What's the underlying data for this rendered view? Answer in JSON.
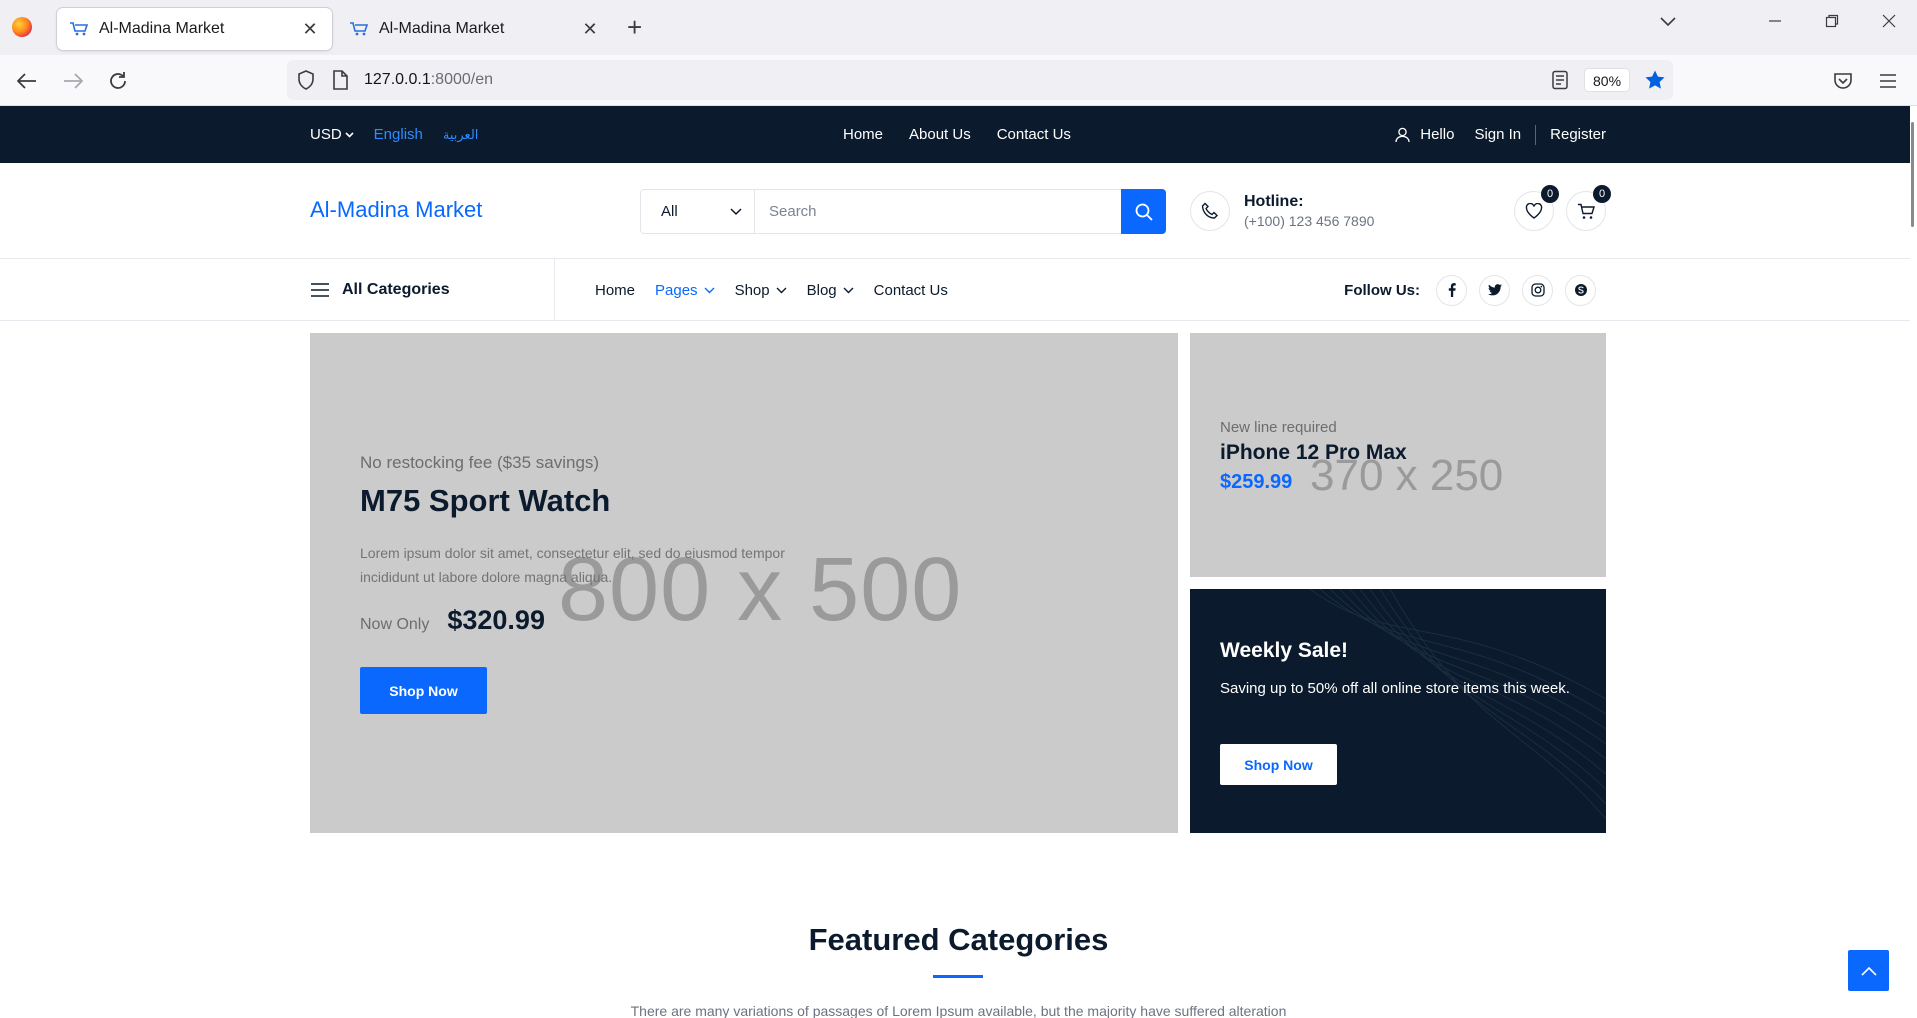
{
  "browser": {
    "tabs": [
      {
        "title": "Al-Madina Market",
        "active": true
      },
      {
        "title": "Al-Madina Market",
        "active": false
      }
    ],
    "url": {
      "host": "127.0.0.1",
      "path": ":8000/en"
    },
    "zoom": "80%"
  },
  "topbar": {
    "currency": "USD",
    "lang_en": "English",
    "lang_ar": "العربية",
    "links": [
      "Home",
      "About Us",
      "Contact Us"
    ],
    "hello": "Hello",
    "sign_in": "Sign In",
    "register": "Register"
  },
  "header": {
    "logo": "Al-Madina Market",
    "search_category": "All",
    "search_placeholder": "Search",
    "hotline_label": "Hotline:",
    "hotline_number": "(+100) 123 456 7890",
    "wishlist_count": "0",
    "cart_count": "0"
  },
  "nav": {
    "all_categories": "All Categories",
    "menu": [
      "Home",
      "Pages",
      "Shop",
      "Blog",
      "Contact Us"
    ],
    "follow_us": "Follow Us:"
  },
  "hero": {
    "placeholder": "800 x 500",
    "subtitle": "No restocking fee ($35 savings)",
    "title": "M75 Sport Watch",
    "description": "Lorem ipsum dolor sit amet, consectetur elit, sed do eiusmod tempor incididunt ut labore dolore magna aliqua.",
    "now_only": "Now Only",
    "price": "$320.99",
    "button": "Shop Now"
  },
  "side_banner_1": {
    "placeholder": "370 x 250",
    "subtitle": "New line required",
    "title": "iPhone 12 Pro Max",
    "price": "$259.99"
  },
  "side_banner_2": {
    "title": "Weekly Sale!",
    "description": "Saving up to 50% off all online store items this week.",
    "button": "Shop Now"
  },
  "featured": {
    "title": "Featured Categories",
    "description": "There are many variations of passages of Lorem Ipsum available, but the majority have suffered alteration"
  },
  "colors": {
    "accent": "#0a68ff",
    "dark": "#0b1a2c",
    "placeholder_bg": "#cbcbcb"
  }
}
